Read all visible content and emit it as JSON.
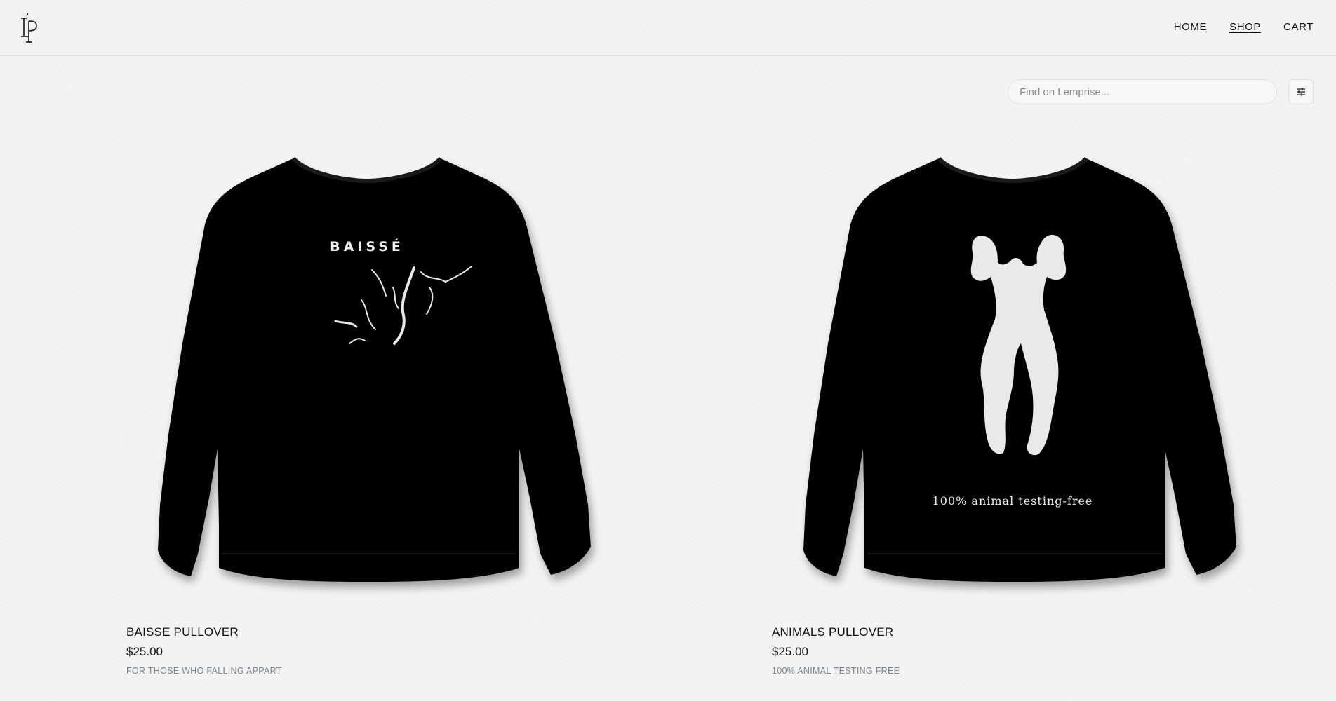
{
  "brand": {
    "logo_icon": "lp-monogram-logo"
  },
  "nav": {
    "items": [
      {
        "label": "HOME",
        "active": false
      },
      {
        "label": "SHOP",
        "active": true
      },
      {
        "label": "CART",
        "active": false
      }
    ]
  },
  "search": {
    "placeholder": "Find on Lemprise...",
    "value": ""
  },
  "filter": {
    "icon": "sliders-icon"
  },
  "products": [
    {
      "name": "BAISSE PULLOVER",
      "price": "$25.00",
      "tagline": "FOR THOSE WHO FALLING APPART",
      "print_text": "BAISSÉ",
      "garment_color": "#060606"
    },
    {
      "name": "ANIMALS PULLOVER",
      "price": "$25.00",
      "tagline": "100% ANIMAL TESTING FREE",
      "print_text": "100% animal testing-free",
      "garment_color": "#060606"
    }
  ]
}
